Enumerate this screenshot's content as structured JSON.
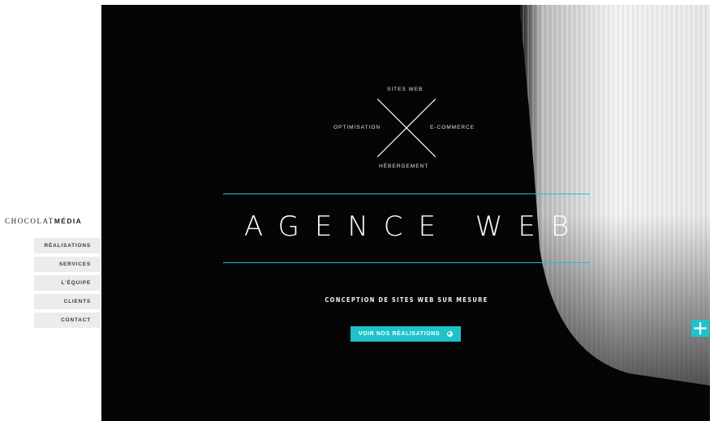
{
  "sidebar": {
    "logo": {
      "part1": "CHOCOLAT",
      "part2": "MÉDIA"
    },
    "nav": [
      {
        "label": "RÉALISATIONS"
      },
      {
        "label": "SERVICES"
      },
      {
        "label": "L'ÉQUIPE"
      },
      {
        "label": "CLIENTS"
      },
      {
        "label": "CONTACT"
      }
    ]
  },
  "hero": {
    "services": {
      "top": "SITES WEB",
      "left": "OPTIMISATION",
      "right": "E-COMMERCE",
      "bottom": "HÉBERGEMENT"
    },
    "title": "AGENCE WEB",
    "subtitle": "CONCEPTION DE SITES WEB SUR MESURE",
    "cta_label": "VOIR NOS RÉALISATIONS",
    "cta_icon": "chevron-right-circle-icon",
    "plus_icon": "plus-icon"
  },
  "colors": {
    "accent": "#1ec3c9",
    "hero_bg": "#050505",
    "nav_bg": "#ececec"
  }
}
